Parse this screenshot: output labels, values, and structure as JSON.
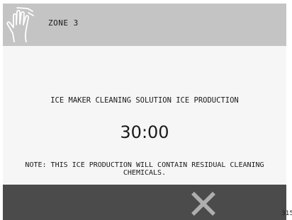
{
  "header": {
    "icon": "hand-icon",
    "title": "ZONE 3"
  },
  "main": {
    "mode_title": "ICE MAKER CLEANING SOLUTION ICE PRODUCTION",
    "timer": "30:00",
    "note": "NOTE: THIS ICE PRODUCTION WILL CONTAIN RESIDUAL CLEANING CHEMICALS."
  },
  "footer": {
    "close_icon": "close-icon"
  },
  "corner_code": "315",
  "colors": {
    "header_bg": "#c4c4c4",
    "body_bg": "#f6f6f6",
    "footer_bg": "#4b4b4b",
    "close_icon": "#aeaeae"
  }
}
